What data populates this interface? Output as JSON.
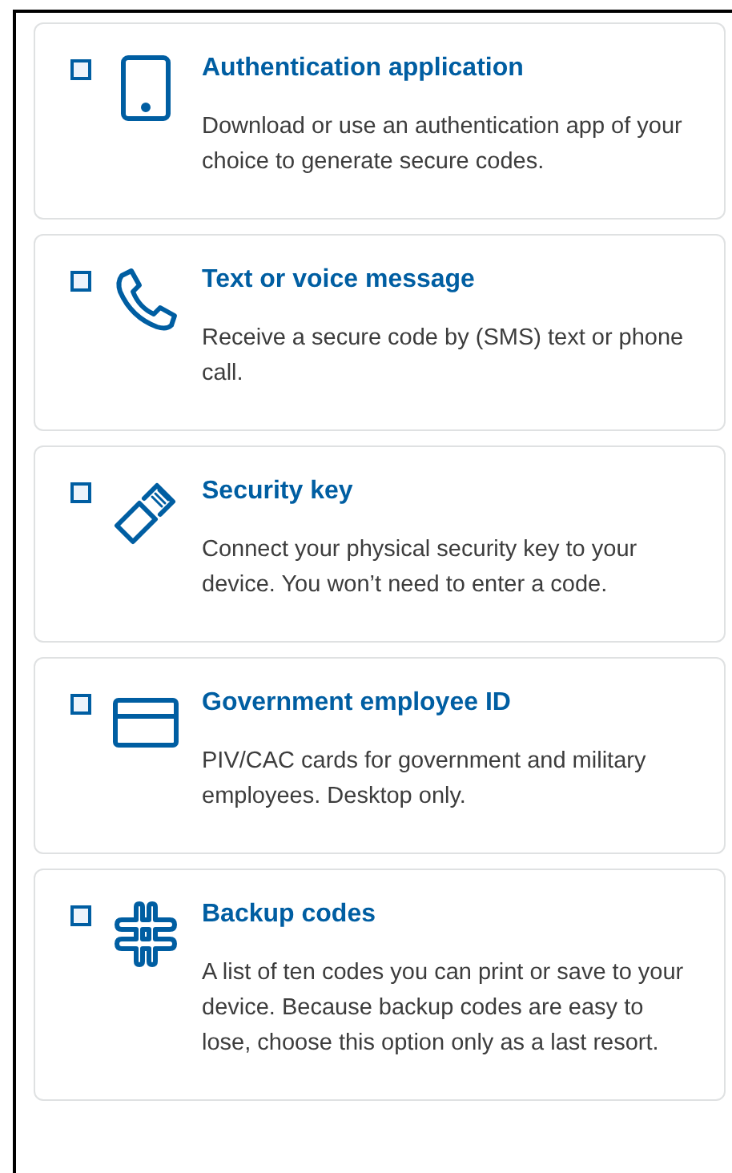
{
  "options": [
    {
      "kind": "phone",
      "checked": false,
      "title": "Authentication application",
      "description": "Download or use an authentication app of your choice to generate secure codes."
    },
    {
      "kind": "call",
      "checked": false,
      "title": "Text or voice message",
      "description": "Receive a secure code by (SMS) text or phone call."
    },
    {
      "kind": "key",
      "checked": false,
      "title": "Security key",
      "description": "Connect your physical security key to your device. You won’t need to enter a code."
    },
    {
      "kind": "card",
      "checked": false,
      "title": "Government employee ID",
      "description": "PIV/CAC cards for government and military employees. Desktop only."
    },
    {
      "kind": "hash",
      "checked": false,
      "title": "Backup codes",
      "description": "A list of ten codes you can print or save to your device. Because backup codes are easy to lose, choose this option only as a last resort."
    }
  ]
}
